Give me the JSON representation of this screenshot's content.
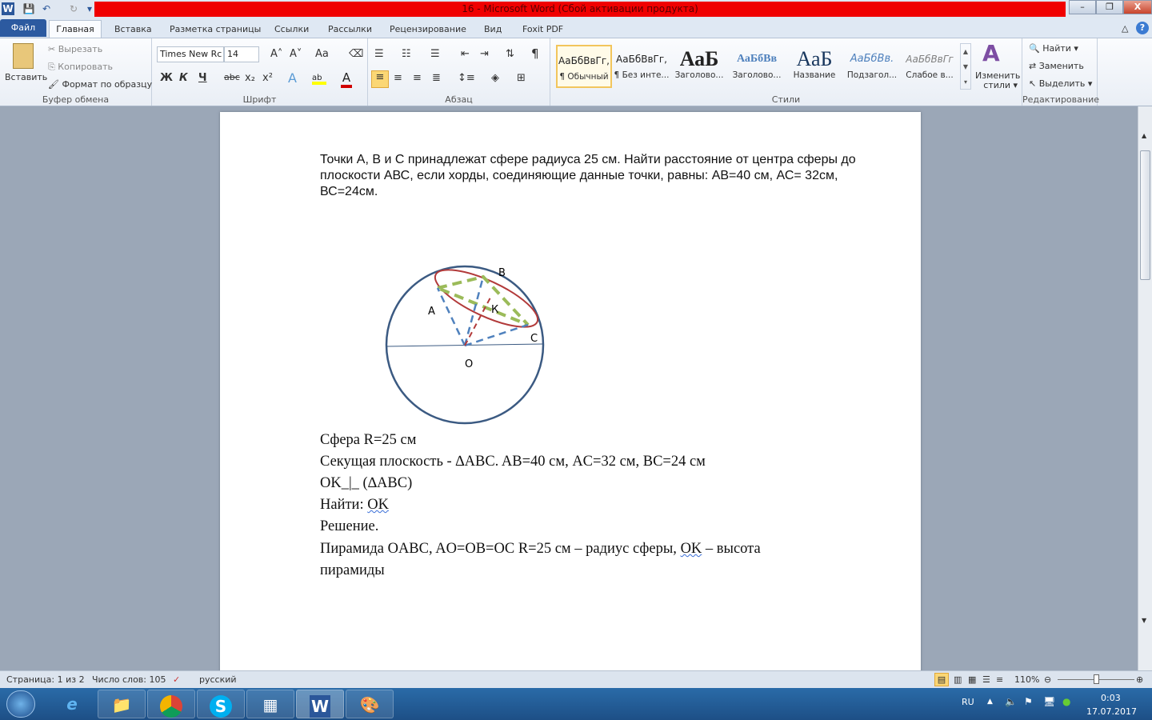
{
  "window": {
    "title": "16  -  Microsoft Word (Сбой активации продукта)",
    "minimize": "–",
    "restore": "❐",
    "close": "X"
  },
  "quick_access": {
    "word": "W",
    "save": "💾",
    "undo": "↶",
    "redo": "↻",
    "customize": "▾"
  },
  "tabs": [
    "Файл",
    "Главная",
    "Вставка",
    "Разметка страницы",
    "Ссылки",
    "Рассылки",
    "Рецензирование",
    "Вид",
    "Foxit PDF"
  ],
  "clipboard": {
    "paste": "Вставить",
    "cut": "Вырезать",
    "copy": "Копировать",
    "format_painter": "Формат по образцу",
    "label": "Буфер обмена"
  },
  "font": {
    "name": "Times New Rc",
    "size": "14",
    "label": "Шрифт",
    "bold": "Ж",
    "italic": "К",
    "underline": "Ч",
    "strike": "abc",
    "sub": "x₂",
    "sup": "x²",
    "grow": "A˄",
    "shrink": "A˅",
    "case": "Aa"
  },
  "paragraph": {
    "label": "Абзац",
    "pilcrow": "¶"
  },
  "styles": {
    "label": "Стили",
    "items": [
      {
        "preview": "АаБбВвГг,",
        "name": "¶ Обычный"
      },
      {
        "preview": "АаБбВвГг,",
        "name": "¶ Без инте..."
      },
      {
        "preview": "АаБ",
        "name": "Заголово..."
      },
      {
        "preview": "АаБбВв",
        "name": "Заголово..."
      },
      {
        "preview": "АаБ",
        "name": "Название"
      },
      {
        "preview": "АаБбВв.",
        "name": "Подзагол..."
      },
      {
        "preview": "АаБбВвГг",
        "name": "Слабое в..."
      }
    ],
    "change": "Изменить",
    "change2": "стили ▾"
  },
  "editing": {
    "label": "Редактирование",
    "find": "Найти ▾",
    "replace": "Заменить",
    "select": "Выделить ▾"
  },
  "document": {
    "problem": "Точки А, В и С принадлежат сфере радиуса 25 см. Найти расстояние от центра сферы до плоскости АВС, если хорды, соединяющие данные точки, равны: АВ=40 см, АС= 32см, ВС=24см.",
    "diagram_labels": {
      "A": "А",
      "B": "В",
      "C": "С",
      "K": "К",
      "O": "О"
    },
    "lines": [
      "Сфера R=25 см",
      "Секущая плоскость - ∆ABC. AB=40 см, AC=32 см, BC=24 см",
      "OK_|_ (∆ABC)",
      "Найти: OK",
      "Решение.",
      "Пирамида OABC, AO=OB=OC R=25 см – радиус сферы, OK – высота",
      "пирамиды"
    ],
    "find_prefix": "Найти: ",
    "find_ok": "OK",
    "pyr_a": "Пирамида OABC, AO=OB=OC R=25 см – радиус сферы, ",
    "pyr_ok": "OK",
    "pyr_b": " – высота"
  },
  "status": {
    "page": "Страница: 1 из 2",
    "words": "Число слов: 105",
    "lang": "русский",
    "zoom": "110%"
  },
  "taskbar": {
    "lang": "RU",
    "time": "0:03",
    "date": "17.07.2017"
  },
  "colors": {
    "title_red": "#f00000",
    "file_tab": "#2c5aa0",
    "circle": "#3b5a82",
    "ellipse": "#b23a3a",
    "triangle": "#9bbb59",
    "radii": "#4f81bd"
  }
}
